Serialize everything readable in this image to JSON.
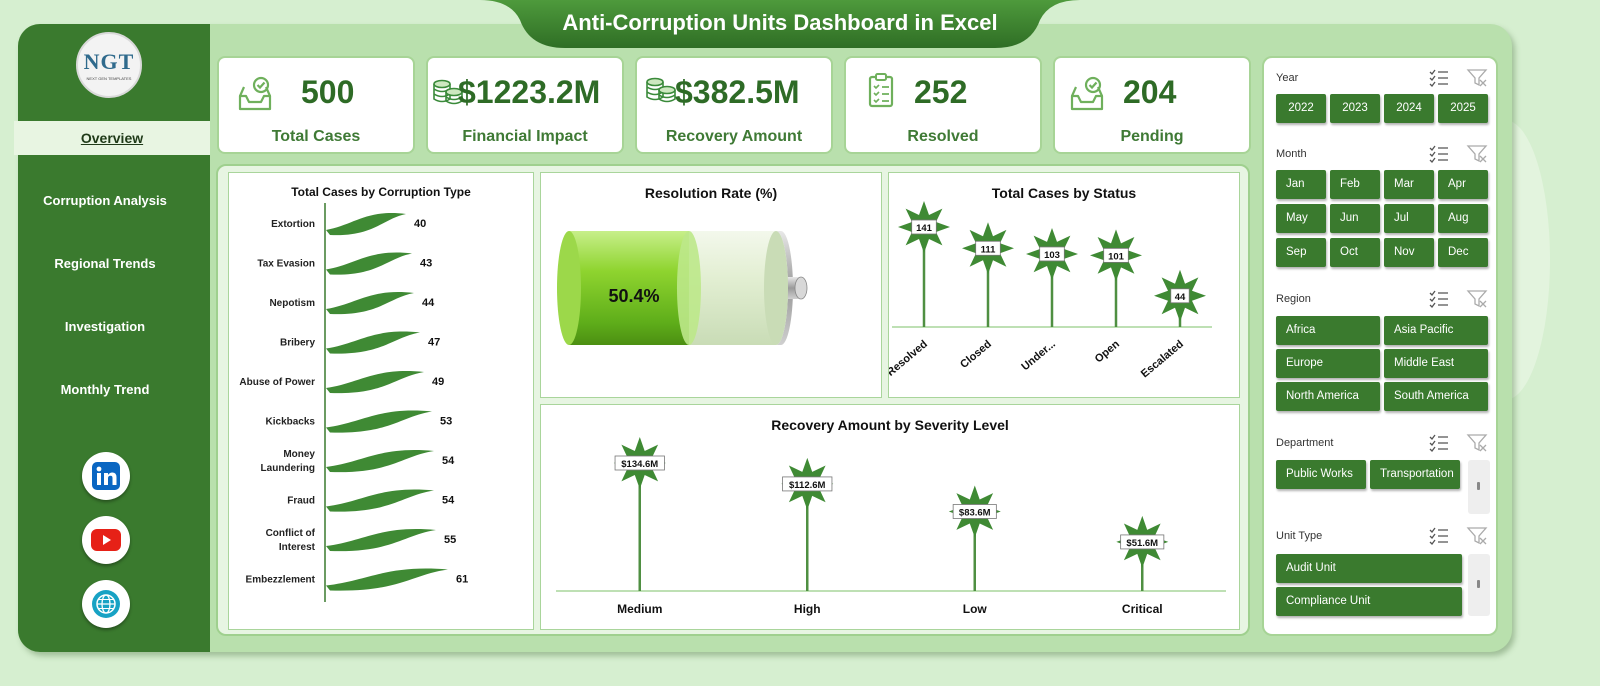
{
  "title": "Anti-Corruption Units Dashboard in Excel",
  "logo": {
    "text": "NGT",
    "subtext": "NEXT GEN TEMPLATES"
  },
  "nav": [
    "Overview",
    "Corruption Analysis",
    "Regional Trends",
    "Investigation",
    "Monthly Trend"
  ],
  "kpis": [
    {
      "value": "500",
      "label": "Total Cases",
      "icon": "inbox-check-icon"
    },
    {
      "value": "$1223.2M",
      "label": "Financial Impact",
      "icon": "coins-icon"
    },
    {
      "value": "$382.5M",
      "label": "Recovery Amount",
      "icon": "coins-icon"
    },
    {
      "value": "252",
      "label": "Resolved",
      "icon": "clipboard-icon"
    },
    {
      "value": "204",
      "label": "Pending",
      "icon": "inbox-check-icon"
    }
  ],
  "filters": {
    "year": {
      "label": "Year",
      "options": [
        "2022",
        "2023",
        "2024",
        "2025"
      ]
    },
    "month": {
      "label": "Month",
      "options": [
        "Jan",
        "Feb",
        "Mar",
        "Apr",
        "May",
        "Jun",
        "Jul",
        "Aug",
        "Sep",
        "Oct",
        "Nov",
        "Dec"
      ]
    },
    "region": {
      "label": "Region",
      "options": [
        "Africa",
        "Asia Pacific",
        "Europe",
        "Middle East",
        "North America",
        "South America"
      ]
    },
    "department": {
      "label": "Department",
      "options": [
        "Public Works",
        "Transportation"
      ]
    },
    "unit_type": {
      "label": "Unit Type",
      "options": [
        "Audit Unit",
        "Compliance Unit"
      ]
    }
  },
  "colors": {
    "primary": "#3a7a2e",
    "accent": "#4f8f42",
    "frame": "#b9e0ad",
    "background": "#d6efd0"
  },
  "chart_data": [
    {
      "type": "bar",
      "orientation": "horizontal",
      "title": "Total Cases by Corruption Type",
      "categories": [
        "Extortion",
        "Tax Evasion",
        "Nepotism",
        "Bribery",
        "Abuse of Power",
        "Kickbacks",
        "Money Laundering",
        "Fraud",
        "Conflict of Interest",
        "Embezzlement"
      ],
      "values": [
        40,
        43,
        44,
        47,
        49,
        53,
        54,
        54,
        55,
        61
      ]
    },
    {
      "type": "gauge",
      "title": "Resolution Rate (%)",
      "value": 50.4,
      "label": "50.4%"
    },
    {
      "type": "lollipop",
      "title": "Total Cases by Status",
      "categories": [
        "Resolved",
        "Closed",
        "Under...",
        "Open",
        "Escalated"
      ],
      "values": [
        141,
        111,
        103,
        101,
        44
      ]
    },
    {
      "type": "lollipop",
      "title": "Recovery Amount by Severity Level",
      "categories": [
        "Medium",
        "High",
        "Low",
        "Critical"
      ],
      "values": [
        134.6,
        112.6,
        83.6,
        51.6
      ],
      "labels": [
        "$134.6M",
        "$112.6M",
        "$83.6M",
        "$51.6M"
      ]
    }
  ]
}
